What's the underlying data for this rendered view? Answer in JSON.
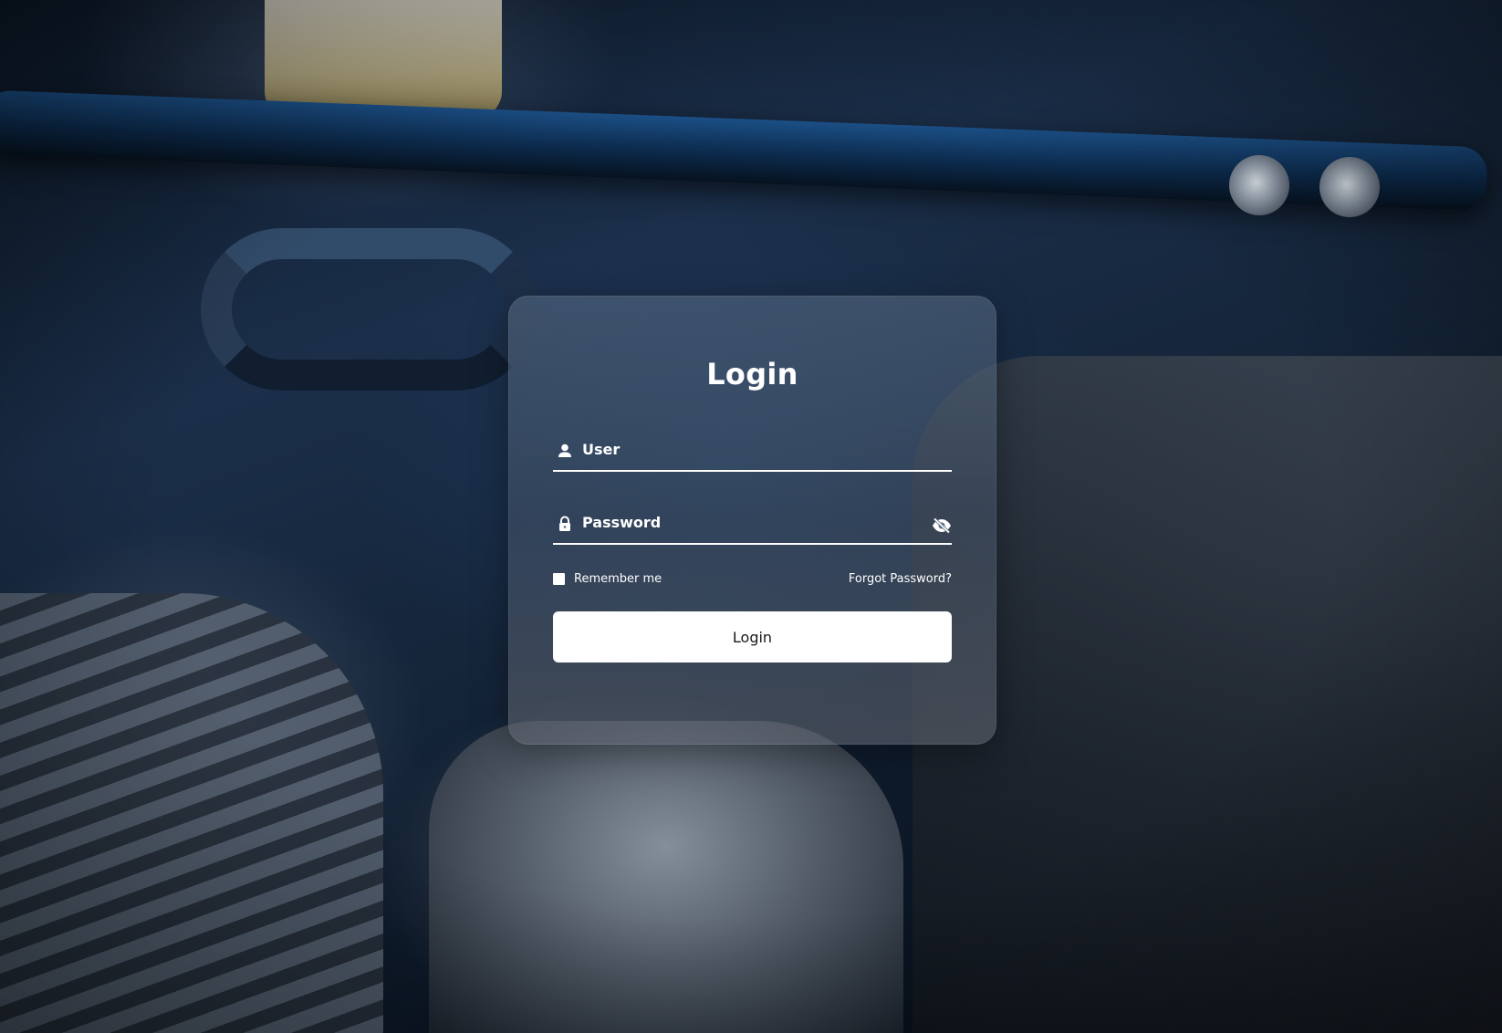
{
  "login": {
    "title": "Login",
    "user_label": "User",
    "password_label": "Password",
    "remember_label": "Remember me",
    "forgot_label": "Forgot Password?",
    "button_label": "Login"
  },
  "icons": {
    "user": "user-icon",
    "lock": "lock-icon",
    "password_toggle": "eye-off-icon"
  },
  "colors": {
    "text": "#ffffff",
    "button_bg": "#ffffff",
    "button_text": "#1a1a1a"
  }
}
